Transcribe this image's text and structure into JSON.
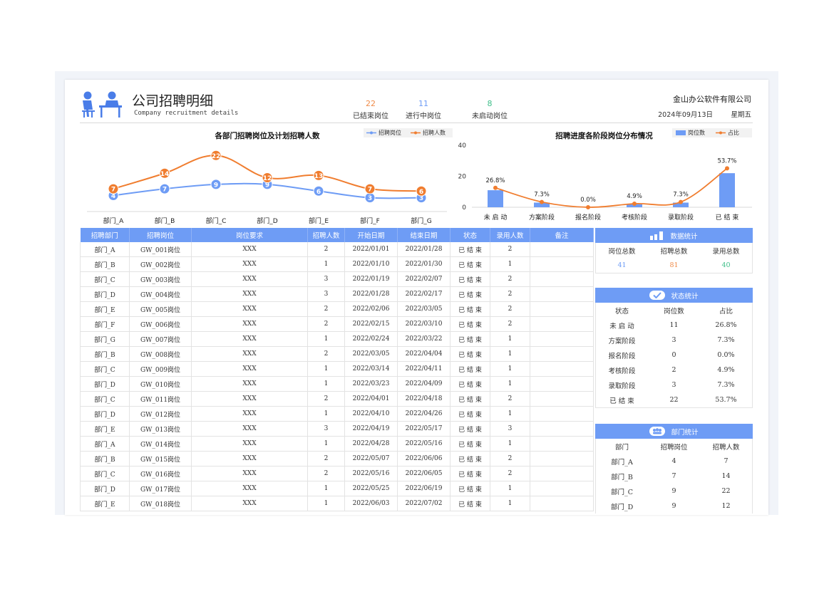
{
  "header": {
    "title": "公司招聘明细",
    "subtitle": "Company recruitment details",
    "company": "金山办公软件有限公司",
    "date": "2024年09月13日",
    "weekday": "星期五",
    "stats": [
      {
        "value": "22",
        "label": "已结束岗位",
        "color": "#f08c4a"
      },
      {
        "value": "11",
        "label": "进行中岗位",
        "color": "#6e9cf5"
      },
      {
        "value": "8",
        "label": "未启动岗位",
        "color": "#3fbf8a"
      }
    ]
  },
  "chart_data": [
    {
      "type": "line",
      "title": "各部门招聘岗位及计划招聘人数",
      "categories": [
        "部门_A",
        "部门_B",
        "部门_C",
        "部门_D",
        "部门_E",
        "部门_F",
        "部门_G"
      ],
      "series": [
        {
          "name": "招聘岗位",
          "values": [
            4,
            7,
            9,
            9,
            6,
            3,
            3
          ],
          "color": "#6e9cf5"
        },
        {
          "name": "招聘人数",
          "values": [
            7,
            14,
            22,
            12,
            13,
            7,
            6
          ],
          "color": "#f07d2f"
        }
      ],
      "legend": "top-right",
      "grid": false
    },
    {
      "type": "bar",
      "title": "招聘进度各阶段岗位分布情况",
      "categories": [
        "未 启 动",
        "方案阶段",
        "报名阶段",
        "考核阶段",
        "录取阶段",
        "已 结 束"
      ],
      "series": [
        {
          "name": "岗位数",
          "values": [
            11,
            3,
            0,
            2,
            3,
            22
          ],
          "color": "#6e9cf5"
        },
        {
          "name": "占比",
          "values": [
            26.8,
            7.3,
            0.0,
            4.9,
            7.3,
            53.7
          ],
          "labels": [
            "26.8%",
            "7.3%",
            "0.0%",
            "4.9%",
            "7.3%",
            "53.7%"
          ],
          "color": "#f07d2f"
        }
      ],
      "y_ticks": [
        "0",
        "20",
        "40"
      ],
      "ylim": [
        0,
        40
      ],
      "legend": "top-right",
      "grid": false
    }
  ],
  "table": {
    "headers": [
      "招聘部门",
      "招聘岗位",
      "岗位要求",
      "招聘人数",
      "开始日期",
      "结束日期",
      "状态",
      "录用人数",
      "备注"
    ],
    "rows": [
      [
        "部门_A",
        "GW_001岗位",
        "XXX",
        "2",
        "2022/01/01",
        "2022/01/28",
        "已 结 束",
        "2",
        ""
      ],
      [
        "部门_B",
        "GW_002岗位",
        "XXX",
        "1",
        "2022/01/10",
        "2022/01/30",
        "已 结 束",
        "1",
        ""
      ],
      [
        "部门_C",
        "GW_003岗位",
        "XXX",
        "3",
        "2022/01/19",
        "2022/02/07",
        "已 结 束",
        "2",
        ""
      ],
      [
        "部门_D",
        "GW_004岗位",
        "XXX",
        "3",
        "2022/01/28",
        "2022/02/17",
        "已 结 束",
        "2",
        ""
      ],
      [
        "部门_E",
        "GW_005岗位",
        "XXX",
        "2",
        "2022/02/06",
        "2022/03/05",
        "已 结 束",
        "2",
        ""
      ],
      [
        "部门_F",
        "GW_006岗位",
        "XXX",
        "2",
        "2022/02/15",
        "2022/03/10",
        "已 结 束",
        "2",
        ""
      ],
      [
        "部门_G",
        "GW_007岗位",
        "XXX",
        "1",
        "2022/02/24",
        "2022/03/22",
        "已 结 束",
        "1",
        ""
      ],
      [
        "部门_B",
        "GW_008岗位",
        "XXX",
        "2",
        "2022/03/05",
        "2022/04/04",
        "已 结 束",
        "1",
        ""
      ],
      [
        "部门_C",
        "GW_009岗位",
        "XXX",
        "1",
        "2022/03/14",
        "2022/04/11",
        "已 结 束",
        "1",
        ""
      ],
      [
        "部门_D",
        "GW_010岗位",
        "XXX",
        "1",
        "2022/03/23",
        "2022/04/09",
        "已 结 束",
        "1",
        ""
      ],
      [
        "部门_C",
        "GW_011岗位",
        "XXX",
        "2",
        "2022/04/01",
        "2022/04/18",
        "已 结 束",
        "2",
        ""
      ],
      [
        "部门_D",
        "GW_012岗位",
        "XXX",
        "1",
        "2022/04/10",
        "2022/04/26",
        "已 结 束",
        "1",
        ""
      ],
      [
        "部门_E",
        "GW_013岗位",
        "XXX",
        "3",
        "2022/04/19",
        "2022/05/17",
        "已 结 束",
        "3",
        ""
      ],
      [
        "部门_A",
        "GW_014岗位",
        "XXX",
        "1",
        "2022/04/28",
        "2022/05/16",
        "已 结 束",
        "1",
        ""
      ],
      [
        "部门_B",
        "GW_015岗位",
        "XXX",
        "2",
        "2022/05/07",
        "2022/06/06",
        "已 结 束",
        "2",
        ""
      ],
      [
        "部门_C",
        "GW_016岗位",
        "XXX",
        "2",
        "2022/05/16",
        "2022/06/05",
        "已 结 束",
        "2",
        ""
      ],
      [
        "部门_D",
        "GW_017岗位",
        "XXX",
        "1",
        "2022/05/25",
        "2022/06/19",
        "已 结 束",
        "1",
        ""
      ],
      [
        "部门_E",
        "GW_018岗位",
        "XXX",
        "1",
        "2022/06/03",
        "2022/07/02",
        "已 结 束",
        "1",
        ""
      ]
    ]
  },
  "data_stats": {
    "title": "数据统计",
    "labels": [
      "岗位总数",
      "招聘总数",
      "录用总数"
    ],
    "values": [
      "41",
      "81",
      "40"
    ],
    "colors": [
      "#6e9cf5",
      "#f08c4a",
      "#3fbf8a"
    ]
  },
  "status_stats": {
    "title": "状态统计",
    "headers": [
      "状态",
      "岗位数",
      "占比"
    ],
    "rows": [
      [
        "未 启 动",
        "11",
        "26.8%"
      ],
      [
        "方案阶段",
        "3",
        "7.3%"
      ],
      [
        "报名阶段",
        "0",
        "0.0%"
      ],
      [
        "考核阶段",
        "2",
        "4.9%"
      ],
      [
        "录取阶段",
        "3",
        "7.3%"
      ],
      [
        "已 结 束",
        "22",
        "53.7%"
      ]
    ]
  },
  "dept_stats": {
    "title": "部门统计",
    "headers": [
      "部门",
      "招聘岗位",
      "招聘人数"
    ],
    "rows": [
      [
        "部门_A",
        "4",
        "7"
      ],
      [
        "部门_B",
        "7",
        "14"
      ],
      [
        "部门_C",
        "9",
        "22"
      ],
      [
        "部门_D",
        "9",
        "12"
      ]
    ]
  }
}
